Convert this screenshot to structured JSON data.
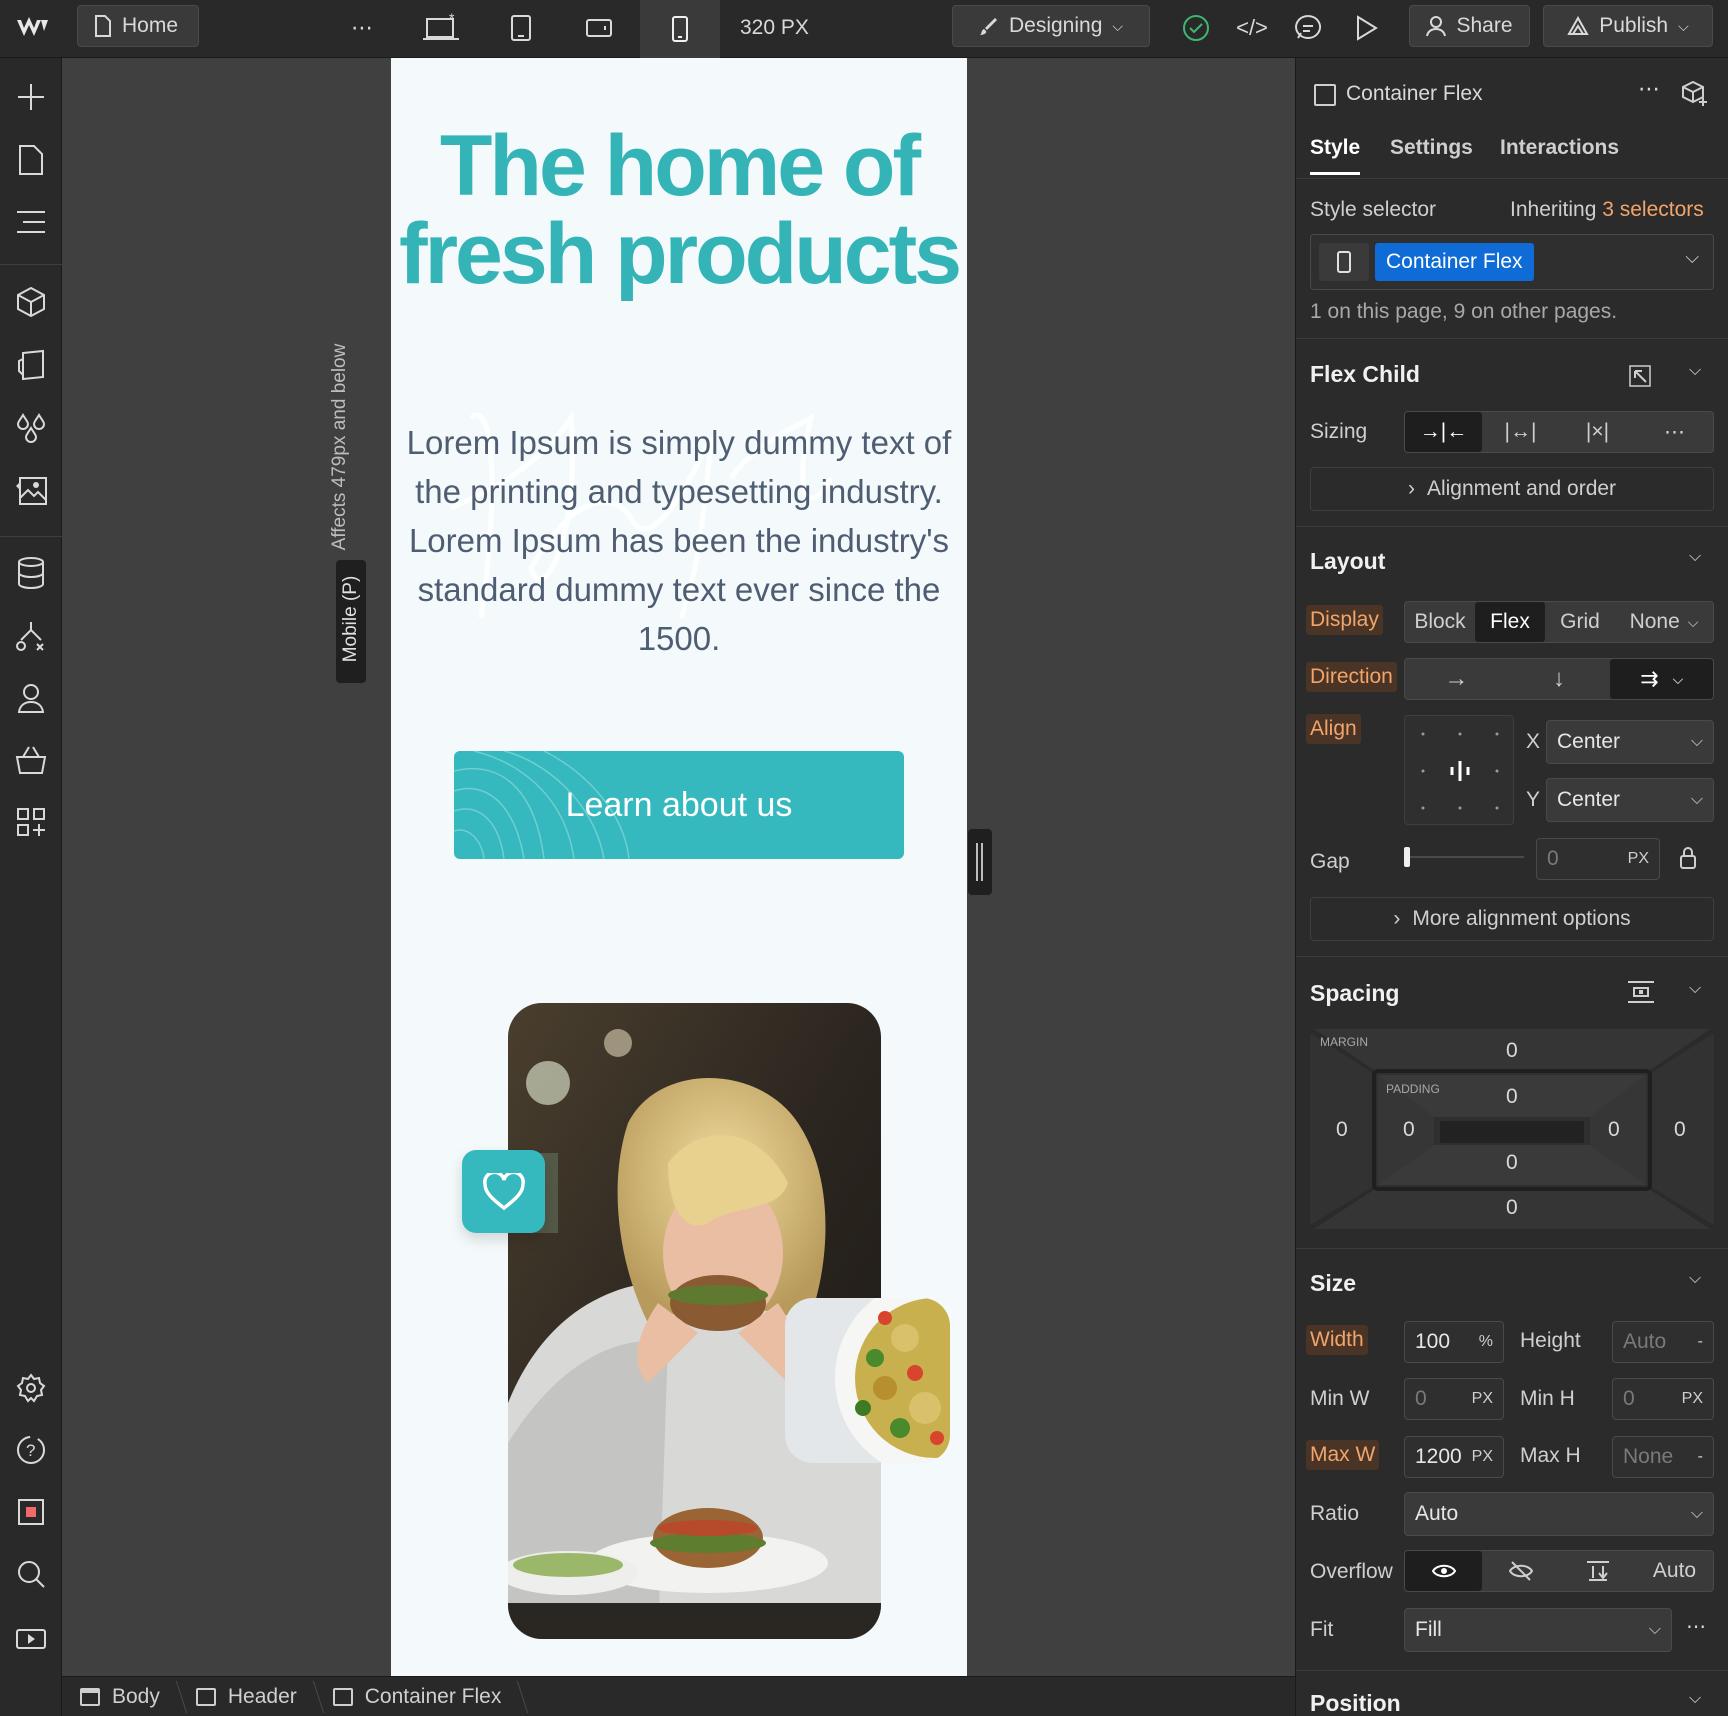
{
  "topbar": {
    "page_name": "Home",
    "breakpoint_width": "320 PX",
    "mode_label": "Designing",
    "share_label": "Share",
    "publish_label": "Publish"
  },
  "canvas": {
    "breakpoint_badge": "Mobile (P)",
    "breakpoint_note": "Affects 479px and below",
    "hero_title": "The home of fresh products",
    "hero_body": "Lorem Ipsum is simply dummy text of the printing and typesetting industry. Lorem Ipsum has been the industry's standard dummy text ever since the 1500.",
    "cta_label": "Learn about us",
    "accent_color": "#35b4b7"
  },
  "panel": {
    "element_name": "Container Flex",
    "tabs": [
      "Style",
      "Settings",
      "Interactions"
    ],
    "style_selector_label": "Style selector",
    "inheriting_prefix": "Inheriting",
    "inheriting_count": "3 selectors",
    "selector_chip": "Container Flex",
    "usage_note": "1 on this page, 9 on other pages.",
    "flex_child": {
      "title": "Flex Child",
      "sizing_label": "Sizing",
      "alignment_link": "Alignment and order"
    },
    "layout": {
      "title": "Layout",
      "display_label": "Display",
      "display_options": [
        "Block",
        "Flex",
        "Grid",
        "None"
      ],
      "display_selected": "Flex",
      "direction_label": "Direction",
      "align_label": "Align",
      "x_label": "X",
      "x_value": "Center",
      "y_label": "Y",
      "y_value": "Center",
      "gap_label": "Gap",
      "gap_value": "0",
      "gap_unit": "PX",
      "more_link": "More alignment options"
    },
    "spacing": {
      "title": "Spacing",
      "margin_label": "MARGIN",
      "padding_label": "PADDING",
      "margin_top": "0",
      "margin_right": "0",
      "margin_bottom": "0",
      "margin_left": "0",
      "padding_top": "0",
      "padding_right": "0",
      "padding_bottom": "0",
      "padding_left": "0"
    },
    "size": {
      "title": "Size",
      "width_label": "Width",
      "width_value": "100",
      "width_unit": "%",
      "height_label": "Height",
      "height_value": "Auto",
      "height_unit": "-",
      "minw_label": "Min W",
      "minw_value": "0",
      "minw_unit": "PX",
      "minh_label": "Min H",
      "minh_value": "0",
      "minh_unit": "PX",
      "maxw_label": "Max W",
      "maxw_value": "1200",
      "maxw_unit": "PX",
      "maxh_label": "Max H",
      "maxh_value": "None",
      "maxh_unit": "-",
      "ratio_label": "Ratio",
      "ratio_value": "Auto",
      "overflow_label": "Overflow",
      "overflow_auto": "Auto",
      "fit_label": "Fit",
      "fit_value": "Fill"
    },
    "position_title": "Position"
  },
  "breadcrumbs": [
    "Body",
    "Header",
    "Container Flex"
  ]
}
